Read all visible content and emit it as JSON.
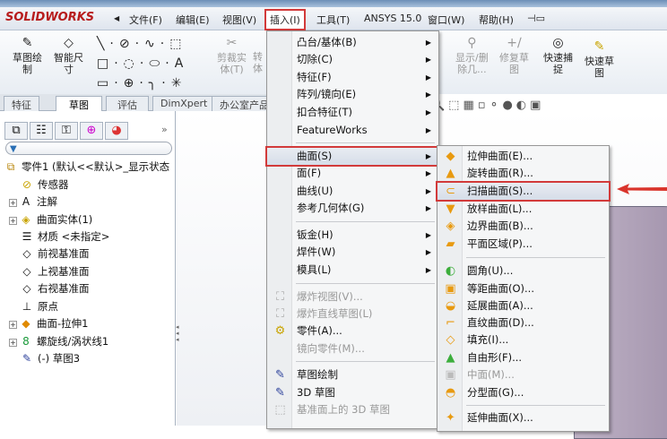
{
  "app": {
    "logo": "SOLIDWORKS",
    "brand_color": "#b71c1c"
  },
  "menubar": {
    "items": [
      "文件(F)",
      "编辑(E)",
      "视图(V)",
      "插入(I)",
      "工具(T)",
      "ANSYS 15.0",
      "窗口(W)",
      "帮助(H)"
    ]
  },
  "toolbar": {
    "sketch": "草图绘\n制",
    "smart_dim": "智能尺\n寸",
    "trim": "剪裁实\n体(T)",
    "convert": "转\n体",
    "show_delete": "显示/删\n除几...",
    "repair": "修复草\n图",
    "quick_snap": "快速捕\n捉",
    "rapid_sketch": "快速草\n图"
  },
  "tabs": [
    "特征",
    "草图",
    "评估",
    "DimXpert",
    "办公室产品"
  ],
  "tree": {
    "root": "零件1  (默认<<默认>_显示状态",
    "items": [
      "传感器",
      "注解",
      "曲面实体(1)",
      "材质 <未指定>",
      "前视基准面",
      "上视基准面",
      "右视基准面",
      "原点",
      "曲面-拉伸1",
      "螺旋线/涡状线1",
      "(-) 草图3"
    ]
  },
  "insert_menu": {
    "items": [
      {
        "label": "凸台/基体(B)",
        "sub": true
      },
      {
        "label": "切除(C)",
        "sub": true
      },
      {
        "label": "特征(F)",
        "sub": true
      },
      {
        "label": "阵列/镜向(E)",
        "sub": true
      },
      {
        "label": "扣合特征(T)",
        "sub": true
      },
      {
        "label": "FeatureWorks",
        "sub": true
      },
      {
        "label": "曲面(S)",
        "sub": true,
        "highlight": true
      },
      {
        "label": "面(F)",
        "sub": true
      },
      {
        "label": "曲线(U)",
        "sub": true
      },
      {
        "label": "参考几何体(G)",
        "sub": true
      },
      {
        "label": "钣金(H)",
        "sub": true
      },
      {
        "label": "焊件(W)",
        "sub": true
      },
      {
        "label": "模具(L)",
        "sub": true
      },
      {
        "label": "爆炸视图(V)...",
        "disabled": true
      },
      {
        "label": "爆炸直线草图(L)",
        "disabled": true
      },
      {
        "label": "零件(A)..."
      },
      {
        "label": "镜向零件(M)...",
        "disabled": true
      },
      {
        "label": "草图绘制"
      },
      {
        "label": "3D 草图"
      },
      {
        "label": "基准面上的 3D 草图",
        "disabled": true
      }
    ]
  },
  "surface_menu": {
    "items": [
      {
        "label": "拉伸曲面(E)..."
      },
      {
        "label": "旋转曲面(R)..."
      },
      {
        "label": "扫描曲面(S)...",
        "highlight": true
      },
      {
        "label": "放样曲面(L)..."
      },
      {
        "label": "边界曲面(B)..."
      },
      {
        "label": "平面区域(P)..."
      },
      {
        "label": "圆角(U)..."
      },
      {
        "label": "等距曲面(O)..."
      },
      {
        "label": "延展曲面(A)..."
      },
      {
        "label": "直纹曲面(D)..."
      },
      {
        "label": "填充(I)..."
      },
      {
        "label": "自由形(F)..."
      },
      {
        "label": "中面(M)...",
        "disabled": true
      },
      {
        "label": "分型面(G)..."
      },
      {
        "label": "延伸曲面(X)..."
      }
    ]
  },
  "colors": {
    "highlight_box": "#d23a3a",
    "arrow": "#d9342b"
  }
}
